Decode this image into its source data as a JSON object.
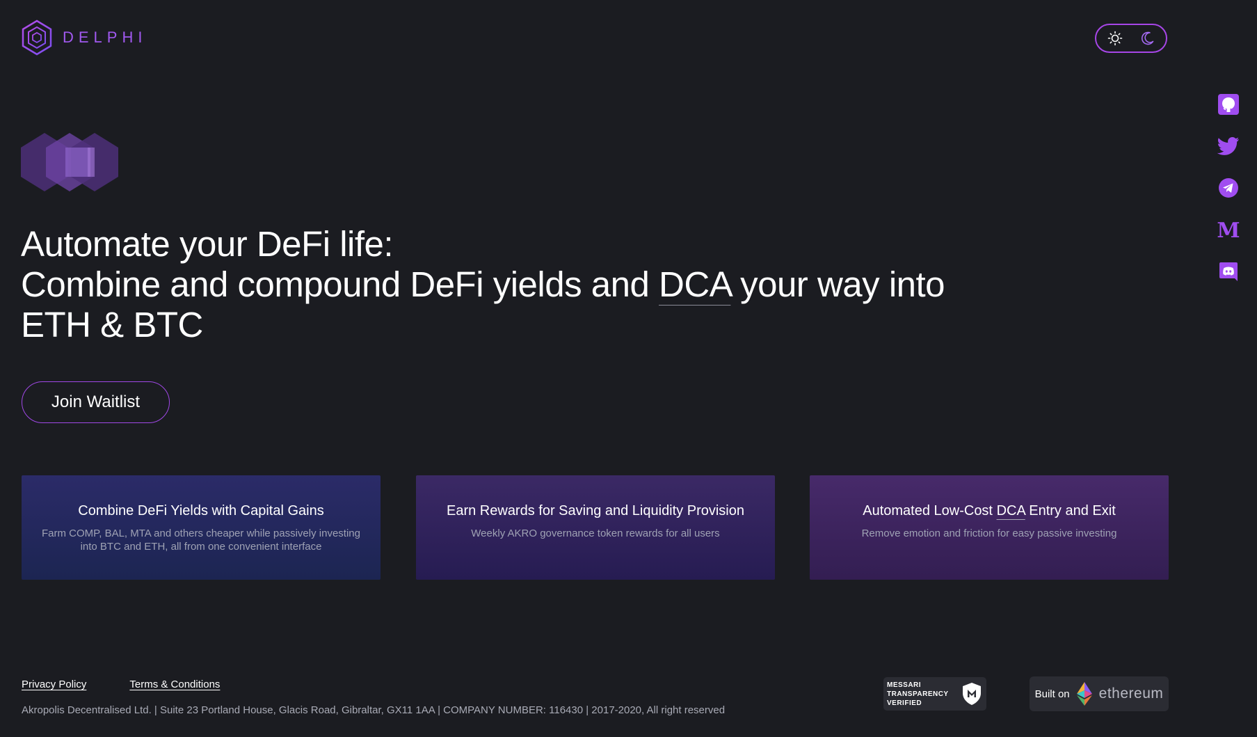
{
  "brand": {
    "name": "DELPHI"
  },
  "colors": {
    "accent": "#a159f0",
    "background": "#1b1c21"
  },
  "theme_toggle": {
    "light_icon": "sun-icon",
    "dark_icon": "moon-icon"
  },
  "social": [
    "github-icon",
    "twitter-icon",
    "telegram-icon",
    "medium-icon",
    "discord-icon"
  ],
  "hero": {
    "line1": "Automate your DeFi life:",
    "line2_pre": "Combine and compound DeFi yields and ",
    "line2_dca": "DCA",
    "line2_post": " your way into",
    "line3": "ETH & BTC",
    "cta": "Join Waitlist"
  },
  "cards": [
    {
      "title": "Combine DeFi Yields with Capital Gains",
      "desc": "Farm COMP, BAL, MTA and others cheaper while passively investing into BTC and ETH, all from one convenient interface"
    },
    {
      "title": "Earn Rewards for Saving and Liquidity Provision",
      "desc": "Weekly AKRO governance token rewards for all users"
    },
    {
      "title_pre": "Automated Low-Cost ",
      "title_dca": "DCA",
      "title_post": " Entry and Exit",
      "desc": "Remove emotion and friction for easy passive investing"
    }
  ],
  "footer": {
    "privacy": "Privacy Policy",
    "terms": "Terms & Conditions",
    "copyright": "Akropolis Decentralised Ltd. | Suite 23 Portland House, Glacis Road, Gibraltar, GX11 1AA | COMPANY NUMBER: 116430 | 2017-2020, All right reserved",
    "messari_line1": "MESSARI",
    "messari_line2": "TRANSPARENCY",
    "messari_line3": "VERIFIED",
    "built_on": "Built on",
    "ethereum": "ethereum"
  }
}
